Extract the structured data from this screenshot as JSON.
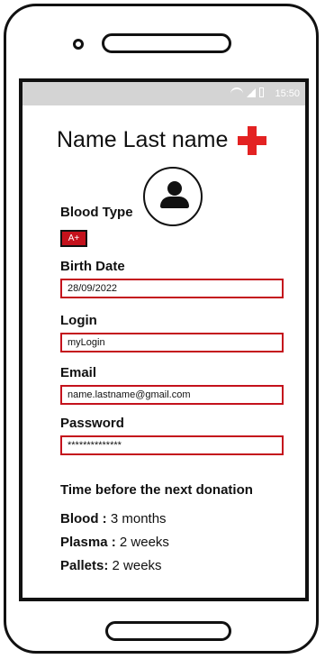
{
  "statusbar": {
    "time": "15:50"
  },
  "profile": {
    "name": "Name Last name",
    "blood_type_label": "Blood Type",
    "blood_type": "A+",
    "birth_date_label": "Birth Date",
    "birth_date": "28/09/2022",
    "login_label": "Login",
    "login": "myLogin",
    "email_label": "Email",
    "email": "name.lastname@gmail.com",
    "password_label": "Password",
    "password": "**************"
  },
  "donation": {
    "title": "Time before the next donation",
    "items": [
      {
        "label": "Blood",
        "sep": " :",
        "value": "3 months"
      },
      {
        "label": "Plasma",
        "sep": " :",
        "value": "2 weeks"
      },
      {
        "label": "Pallets:",
        "sep": "",
        "value": "2 weeks"
      }
    ]
  },
  "colors": {
    "accent": "#c4121c",
    "cross": "#e32222",
    "statusbar": "#d4d4d4"
  },
  "icons": {
    "avatar": "user-avatar-icon",
    "brand": "red-cross-icon",
    "camera": "camera-icon",
    "speaker": "speaker-icon",
    "home": "home-button-icon"
  }
}
